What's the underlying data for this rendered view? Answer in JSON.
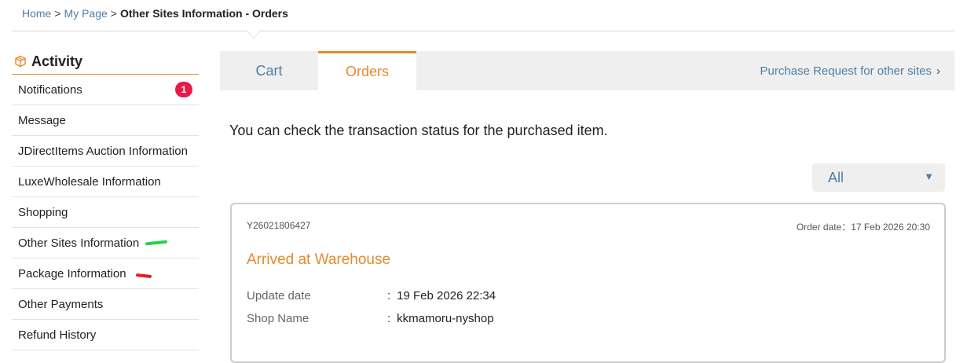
{
  "breadcrumb": {
    "home": "Home",
    "separator": ">",
    "my_page": "My Page",
    "current": "Other Sites Information - Orders"
  },
  "sidebar": {
    "title": "Activity",
    "title_icon": "package-box-icon",
    "items": [
      {
        "label": "Notifications",
        "badge": "1"
      },
      {
        "label": "Message"
      },
      {
        "label": "JDirectItems Auction Information"
      },
      {
        "label": "LuxeWholesale Information"
      },
      {
        "label": "Shopping"
      },
      {
        "label": "Other Sites Information",
        "annotation": "green-marker"
      },
      {
        "label": "Package Information",
        "annotation": "red-marker"
      },
      {
        "label": "Other Payments"
      },
      {
        "label": "Refund History"
      }
    ]
  },
  "tabs": {
    "cart": "Cart",
    "orders": "Orders",
    "active": "Orders",
    "purchase_request": "Purchase Request for other sites",
    "chevron": "›"
  },
  "intro_text": "You can check the transaction status for the purchased item.",
  "filter": {
    "selected": "All",
    "arrow": "▼"
  },
  "order": {
    "id": "Y26021806427",
    "order_date_label": "Order date",
    "order_date_sep": "：",
    "order_date": "17 Feb 2026 20:30",
    "status": "Arrived at Warehouse",
    "fields": [
      {
        "label": "Update date",
        "sep": ":",
        "value": "19 Feb 2026 22:34"
      },
      {
        "label": "Shop Name",
        "sep": ":",
        "value": "kkmamoru-nyshop"
      }
    ]
  },
  "colors": {
    "accent_orange": "#e48a2c",
    "link_blue": "#4f7fa3",
    "badge_red": "#e8194a"
  }
}
